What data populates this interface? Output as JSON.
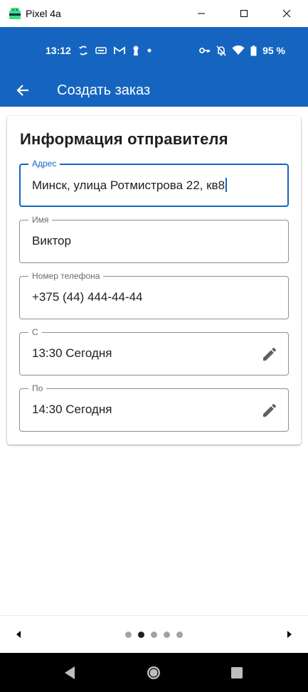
{
  "window": {
    "title": "Pixel 4a"
  },
  "status_bar": {
    "time": "13:12",
    "battery": "95 %"
  },
  "app_bar": {
    "title": "Создать заказ"
  },
  "form": {
    "heading": "Информация отправителя",
    "fields": [
      {
        "label": "Адрес",
        "value": "Минск, улица Ротмистрова 22, кв8",
        "focused": true
      },
      {
        "label": "Имя",
        "value": "Виктор"
      },
      {
        "label": "Номер телефона",
        "value": "+375 (44) 444-44-44"
      },
      {
        "label": "С",
        "value": "13:30 Сегодня",
        "icon": "edit-icon"
      },
      {
        "label": "По",
        "value": "14:30 Сегодня",
        "icon": "edit-icon"
      }
    ]
  },
  "pager": {
    "page_count": 5,
    "current_page": 2
  },
  "colors": {
    "primary": "#1565c0",
    "focus": "#1565c0",
    "nav_bar": "#000000"
  }
}
